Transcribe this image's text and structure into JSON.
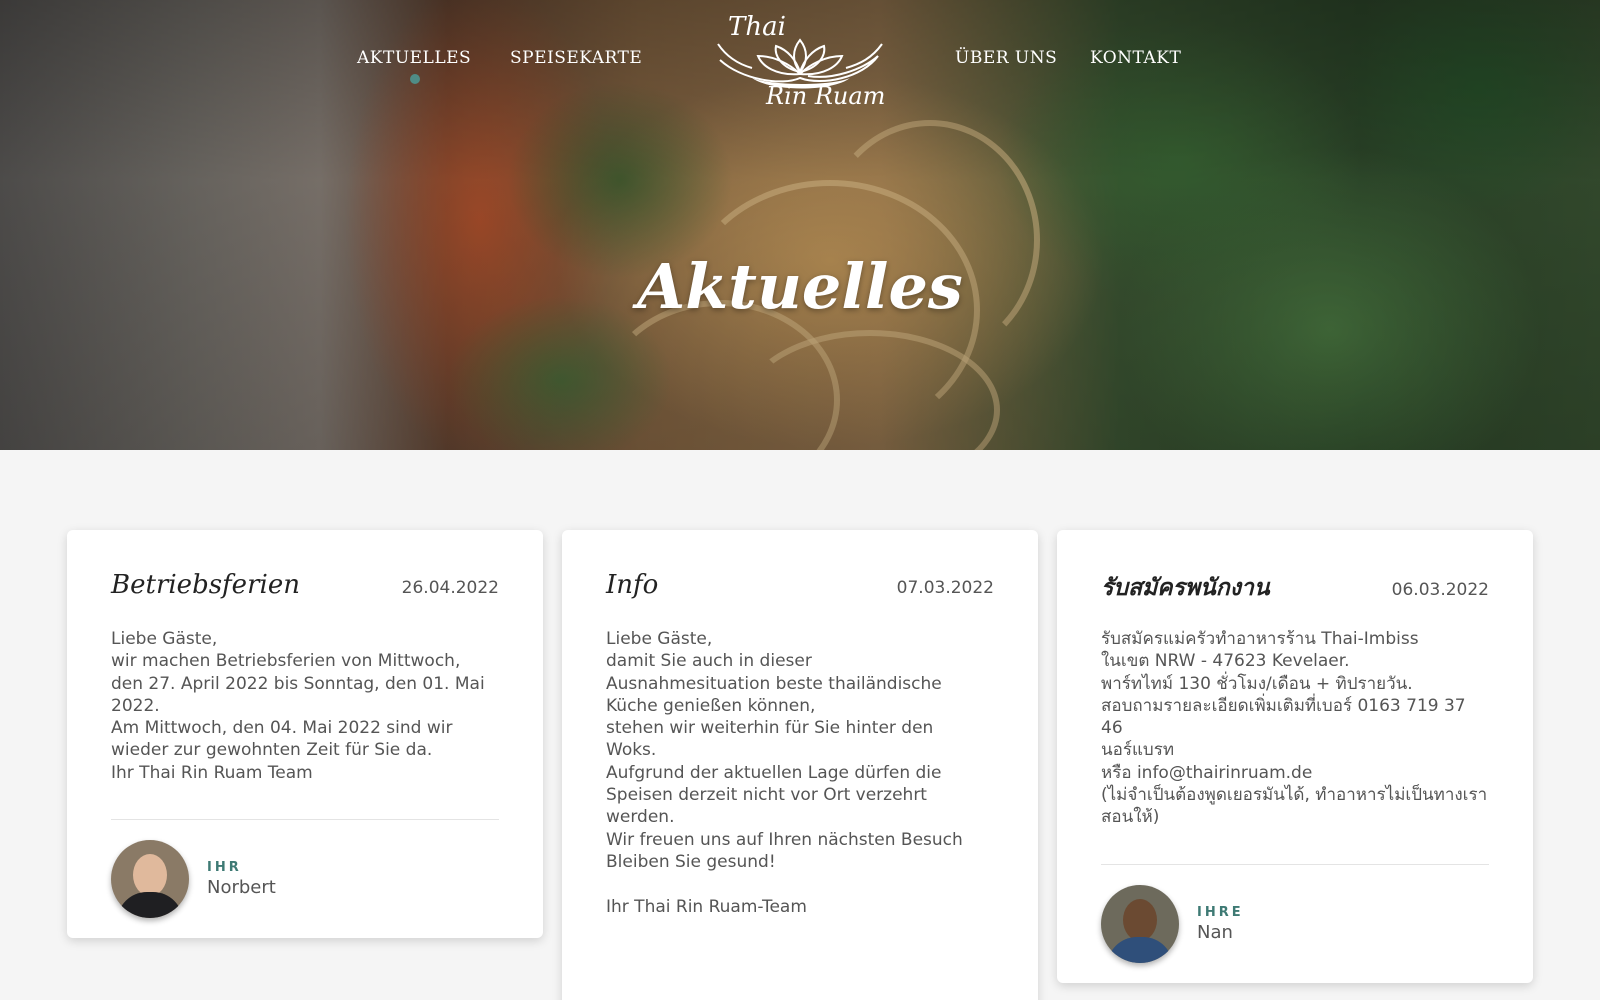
{
  "nav": {
    "left": [
      "AKTUELLES",
      "SPEISEKARTE"
    ],
    "right": [
      "ÜBER UNS",
      "KONTAKT"
    ],
    "active": "AKTUELLES",
    "accent_color": "#4f8c86"
  },
  "logo": {
    "line1": "Thai",
    "line2": "Rin Ruam",
    "icon": "lotus-icon"
  },
  "hero": {
    "title": "Aktuelles"
  },
  "cards": [
    {
      "title": "Betriebsferien",
      "date": "26.04.2022",
      "body": "Liebe Gäste,\nwir machen Betriebsferien von Mittwoch,\nden 27. April 2022 bis Sonntag, den 01. Mai\n2022.\nAm Mittwoch, den 04. Mai 2022 sind wir\nwieder zur gewohnten Zeit für Sie da.\nIhr Thai Rin Ruam Team",
      "author_role": "IHR",
      "author_name": "Norbert"
    },
    {
      "title": "Info",
      "date": "07.03.2022",
      "body": "Liebe Gäste,\ndamit Sie auch in dieser\nAusnahmesituation beste thailändische\nKüche genießen können,\nstehen wir weiterhin für Sie hinter den\nWoks.\nAufgrund der aktuellen Lage dürfen die\nSpeisen derzeit nicht vor Ort verzehrt\nwerden.\nWir freuen uns auf Ihren nächsten Besuch\nBleiben Sie gesund!\n\nIhr Thai Rin Ruam-Team"
    },
    {
      "title": "รับสมัครพนักงาน",
      "date": "06.03.2022",
      "body": "รับสมัครแม่ครัวทำอาหารร้าน Thai-Imbiss\nในเขต NRW - 47623 Kevelaer.\nพาร์ทไทม์ 130 ชั่วโมง/เดือน + ทิปรายวัน.\nสอบถามรายละเอียดเพิ่มเติมที่เบอร์ 0163 719 37 46\nนอร์แบรท\nหรือ info@thairinruam.de\n(ไม่จำเป็นต้องพูดเยอรมันได้, ทำอาหารไม่เป็นทางเรา\nสอนให้)",
      "author_role": "IHRE",
      "author_name": "Nan"
    }
  ]
}
